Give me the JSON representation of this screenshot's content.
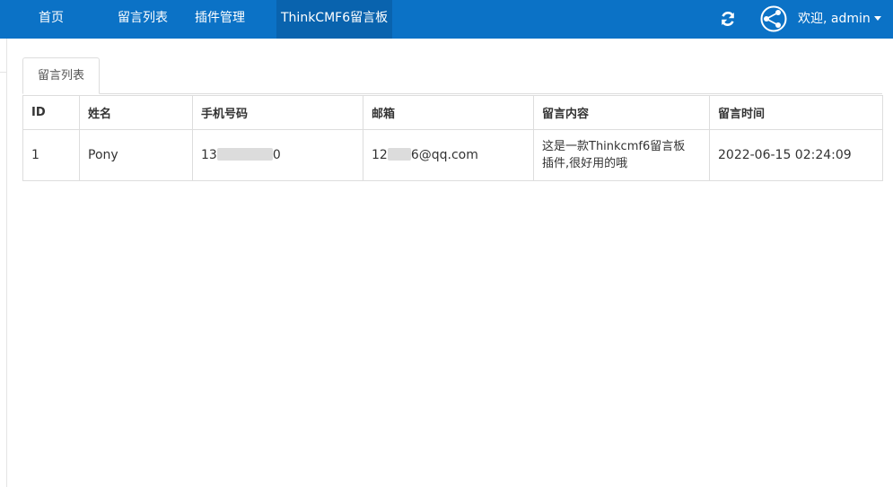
{
  "nav": {
    "items": [
      {
        "label": "首页"
      },
      {
        "label": "留言列表"
      },
      {
        "label": "插件管理"
      },
      {
        "label": "ThinkCMF6留言板"
      }
    ],
    "welcome": "欢迎, admin"
  },
  "tab": {
    "label": "留言列表"
  },
  "table": {
    "headers": [
      "ID",
      "姓名",
      "手机号码",
      "邮箱",
      "留言内容",
      "留言时间"
    ],
    "rows": [
      {
        "id": "1",
        "name": "Pony",
        "phone_start": "13",
        "phone_end": "0",
        "email_start": "12",
        "email_end": "6@qq.com",
        "content": "这是一款Thinkcmf6留言板插件,很好用的哦",
        "time": "2022-06-15 02:24:09"
      }
    ]
  },
  "colors": {
    "topbar": "#0b72c6",
    "active_nav": "#0963ae",
    "border": "#dddddd"
  },
  "icons": {
    "refresh": "refresh-icon",
    "avatar": "user-avatar-icon"
  }
}
